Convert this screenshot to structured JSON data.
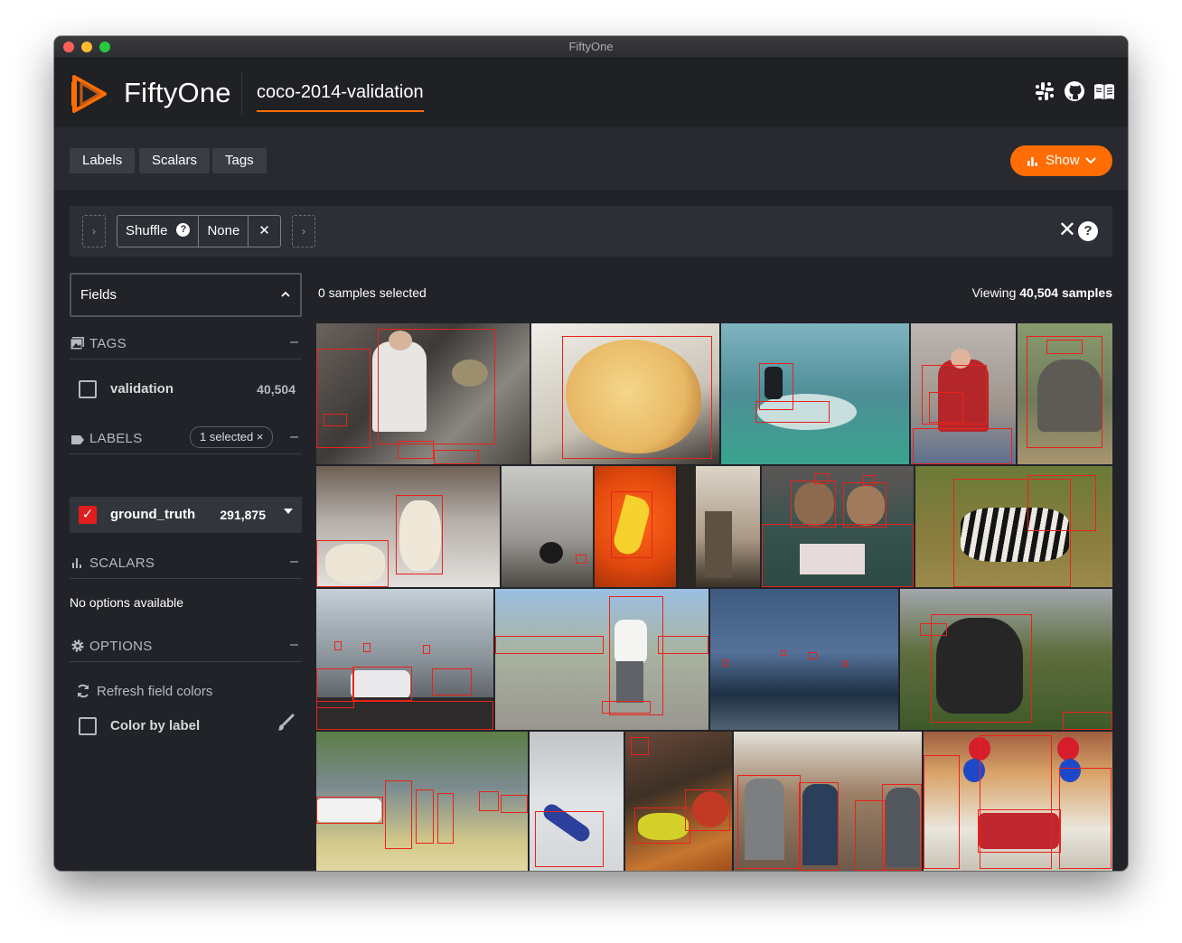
{
  "window": {
    "title": "FiftyOne"
  },
  "header": {
    "app_name": "FiftyOne",
    "dataset_name": "coco-2014-validation",
    "icons": [
      "slack-icon",
      "github-icon",
      "docs-icon"
    ]
  },
  "toolbar": {
    "tabs": [
      "Labels",
      "Scalars",
      "Tags"
    ],
    "show_label": "Show"
  },
  "view_bar": {
    "stage_name": "Shuffle",
    "stage_help": "?",
    "stage_param": "None",
    "stage_remove": "✕",
    "add_stage": "›",
    "clear": "✕",
    "help": "?"
  },
  "sidebar": {
    "fields_label": "Fields",
    "tags": {
      "header": "TAGS",
      "items": [
        {
          "label": "validation",
          "count": "40,504"
        }
      ]
    },
    "labels": {
      "header": "LABELS",
      "selected_pill": "1 selected ×",
      "items": [
        {
          "label": "ground_truth",
          "count": "291,875"
        }
      ]
    },
    "scalars": {
      "header": "SCALARS",
      "empty": "No options available"
    },
    "options": {
      "header": "OPTIONS",
      "refresh": "Refresh field colors",
      "color_by_label": "Color by label"
    },
    "collapse_symbol": "–"
  },
  "main": {
    "selected_text": "0 samples selected",
    "viewing_prefix": "Viewing ",
    "viewing_count": "40,504 samples"
  },
  "colors": {
    "accent": "#ff6d04",
    "box": "#e8231a",
    "background": "#212329"
  }
}
